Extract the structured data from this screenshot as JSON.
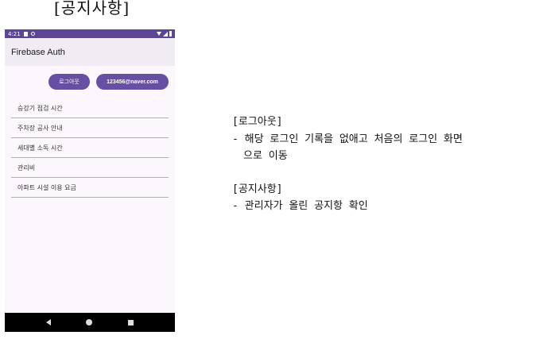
{
  "heading": "[공지사항]",
  "status_bar": {
    "time": "4:21"
  },
  "app_bar": {
    "title": "Firebase Auth"
  },
  "actions": {
    "logout_label": "로그아웃",
    "email_label": "123456@naver.com"
  },
  "notices": [
    "승강기 점검 시간",
    "주차장 공사 안내",
    "세대별 소독 시간",
    "관리비",
    "아파트 시설 이용 요금"
  ],
  "descriptions": {
    "logout_title": "[로그아웃]",
    "logout_line1": "- 해당 로그인 기록을 없애고 처음의 로그인 화면",
    "logout_line2": "으로 이동",
    "notice_title": "[공지사항]",
    "notice_line1": "- 관리자가 올린 공지항 확인"
  },
  "colors": {
    "status_bar": "#5d4595",
    "button": "#6750a4",
    "app_bar": "#f1ebf4",
    "screen_bg": "#fcf7fc"
  }
}
